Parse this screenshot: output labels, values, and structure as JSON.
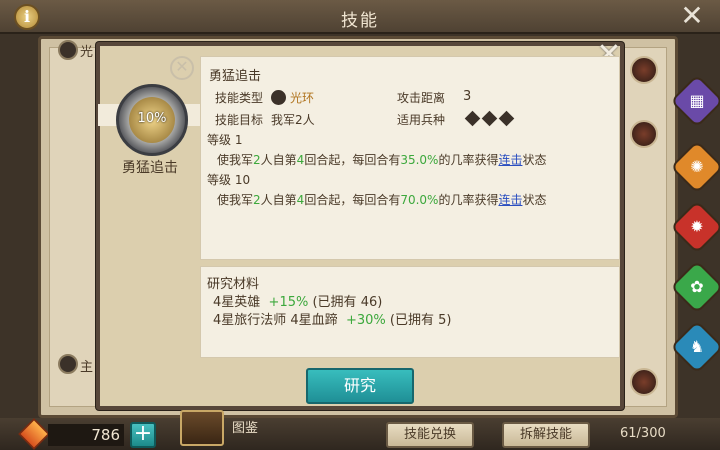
{
  "header": {
    "title": "技能",
    "info_icon": "info-icon",
    "close_icon": "close-icon"
  },
  "background": {
    "label_top": "光",
    "label_bottom": "主"
  },
  "dialog": {
    "medal_percent": "10%",
    "medal_name": "勇猛追击",
    "skill_title": "勇猛追击",
    "type_label": "技能类型",
    "type_value": "光环",
    "target_label": "技能目标",
    "target_value": "我军2人",
    "range_label": "攻击距离",
    "range_value": "3",
    "unit_label": "适用兵种",
    "levels": [
      {
        "label": "等级 1",
        "desc_pre": "使我军",
        "desc_n1": "2",
        "desc_mid1": "人自第",
        "desc_n2": "4",
        "desc_mid2": "回合起，每回合有",
        "desc_pct": "35.0%",
        "desc_mid3": "的几率获得",
        "desc_link": "连击",
        "desc_post": "状态"
      },
      {
        "label": "等级 10",
        "desc_pre": "使我军",
        "desc_n1": "2",
        "desc_mid1": "人自第",
        "desc_n2": "4",
        "desc_mid2": "回合起，每回合有",
        "desc_pct": "70.0%",
        "desc_mid3": "的几率获得",
        "desc_link": "连击",
        "desc_post": "状态"
      }
    ],
    "materials_title": "研究材料",
    "materials": [
      {
        "name": "4星英雄",
        "bonus": "+15%",
        "owned": "(已拥有 46)"
      },
      {
        "name": "4星旅行法师 4星血蹄",
        "bonus": "+30%",
        "owned": "(已拥有 5)"
      }
    ],
    "research_button": "研究"
  },
  "bottom": {
    "gem_count": "786",
    "plus": "+",
    "codex_label": "图鉴",
    "skill_exchange": "技能兑换",
    "skill_disassemble": "拆解技能",
    "capacity": "61/300"
  },
  "colors": {
    "accent_gold": "#b0741e",
    "accent_green": "#3ca83c",
    "link_blue": "#2a4ec0",
    "button_teal": "#1f8f96"
  }
}
